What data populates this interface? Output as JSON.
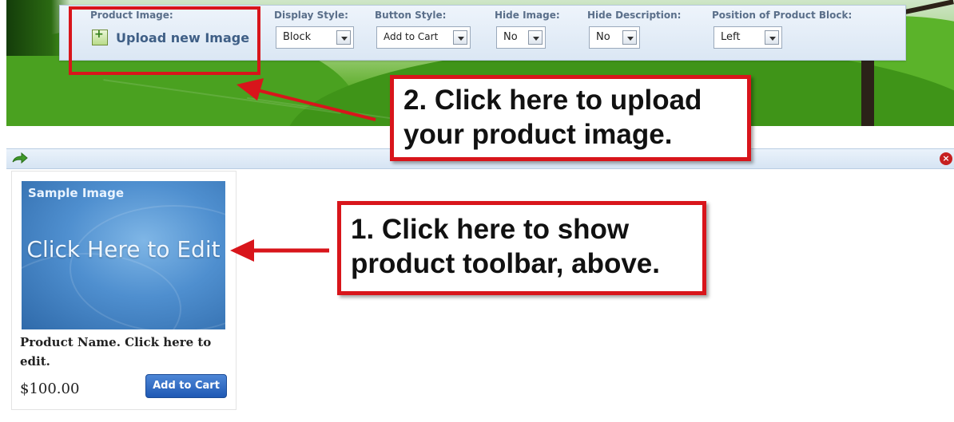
{
  "toolbar": {
    "product_image_label": "Product Image:",
    "upload_label": "Upload new Image",
    "display_style": {
      "label": "Display Style:",
      "value": "Block"
    },
    "button_style": {
      "label": "Button Style:",
      "value": "Add to Cart"
    },
    "hide_image": {
      "label": "Hide Image:",
      "value": "No"
    },
    "hide_description": {
      "label": "Hide Description:",
      "value": "No"
    },
    "position_block": {
      "label": "Position of Product Block:",
      "value": "Left"
    }
  },
  "callouts": {
    "upload_hint": "2. Click here to upload your product image.",
    "toolbar_hint": "1. Click here to show product toolbar, above."
  },
  "product": {
    "image_title": "Sample Image",
    "image_cta": "Click Here to Edit",
    "name": "Product Name. Click here to edit.",
    "price": "$100.00",
    "button": "Add to Cart"
  },
  "colors": {
    "highlight": "#d8151b",
    "button": "#1f59b4"
  }
}
